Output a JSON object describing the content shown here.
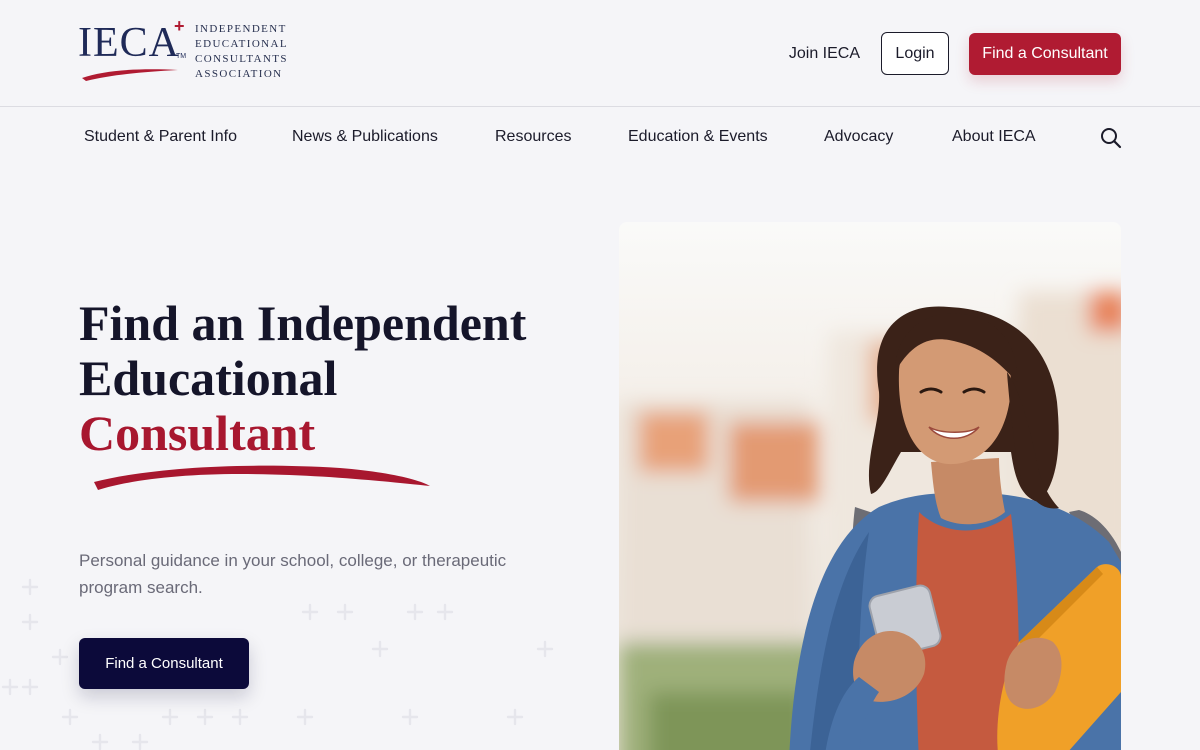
{
  "logo": {
    "letters": "IECA",
    "plus": "+",
    "tm": "TM",
    "lines": [
      "Independent",
      "Educational",
      "Consultants",
      "Association"
    ]
  },
  "header": {
    "join_label": "Join IECA",
    "login_label": "Login",
    "find_label": "Find a Consultant"
  },
  "nav": {
    "items": [
      {
        "label": "Student & Parent Info"
      },
      {
        "label": "News & Publications"
      },
      {
        "label": "Resources"
      },
      {
        "label": "Education & Events"
      },
      {
        "label": "Advocacy"
      },
      {
        "label": "About IECA"
      }
    ],
    "search_icon": "search-icon"
  },
  "hero": {
    "title_line1": "Find an Independent",
    "title_line2": "Educational",
    "title_accent": "Consultant",
    "subtitle": "Personal guidance in your school, college, or therapeutic program search.",
    "cta_label": "Find a Consultant"
  },
  "colors": {
    "brand_red": "#b01b32",
    "navy": "#0c0a3a",
    "background": "#f5f5f8"
  }
}
